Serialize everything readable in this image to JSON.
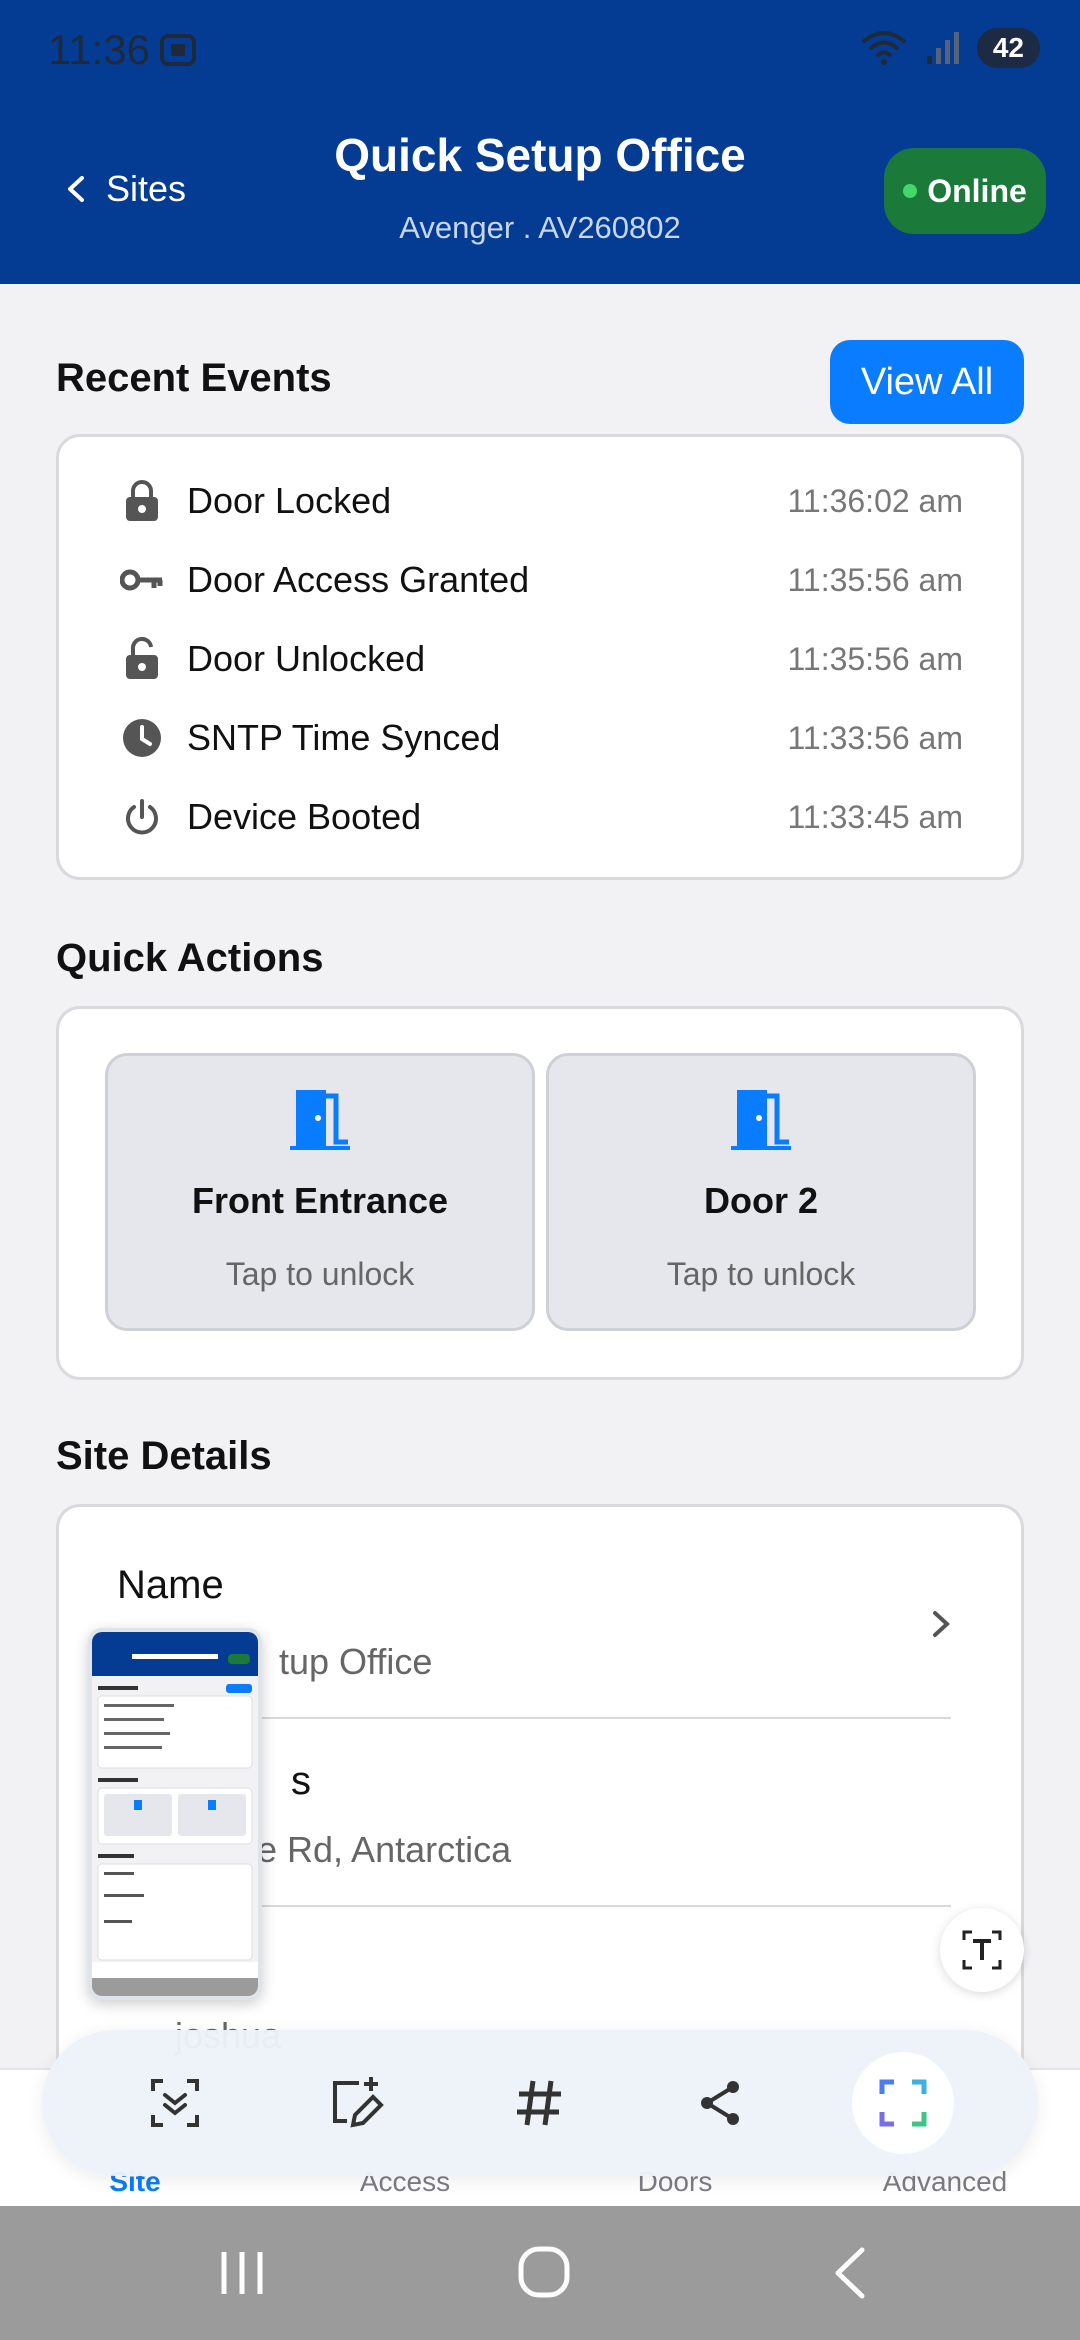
{
  "status": {
    "time": "11:36",
    "battery": "42"
  },
  "header": {
    "back_label": "Sites",
    "title": "Quick Setup Office",
    "subtitle": "Avenger . AV260802",
    "online_label": "Online"
  },
  "recent_events": {
    "title": "Recent Events",
    "view_all_label": "View All",
    "items": [
      {
        "icon": "lock-icon",
        "label": "Door Locked",
        "time": "11:36:02 am"
      },
      {
        "icon": "key-icon",
        "label": "Door Access Granted",
        "time": "11:35:56 am"
      },
      {
        "icon": "lock-open-icon",
        "label": "Door Unlocked",
        "time": "11:35:56 am"
      },
      {
        "icon": "clock-icon",
        "label": "SNTP Time Synced",
        "time": "11:33:56 am"
      },
      {
        "icon": "power-icon",
        "label": "Device Booted",
        "time": "11:33:45 am"
      }
    ]
  },
  "quick_actions": {
    "title": "Quick Actions",
    "items": [
      {
        "icon": "door-icon",
        "name": "Front Entrance",
        "subtitle": "Tap to unlock"
      },
      {
        "icon": "door-icon",
        "name": "Door 2",
        "subtitle": "Tap to unlock"
      }
    ]
  },
  "site_details": {
    "title": "Site Details",
    "name_label": "Name",
    "name_value_partial": "tup Office",
    "address_label_partial": "s",
    "address_value_partial": "e Rd, Antarctica",
    "owner_value_partial": "joshua"
  },
  "bottom_nav": {
    "items": [
      {
        "label": "Site",
        "active": true
      },
      {
        "label": "Access",
        "active": false
      },
      {
        "label": "Doors",
        "active": false
      },
      {
        "label": "Advanced",
        "active": false
      }
    ]
  },
  "colors": {
    "header_bg": "#043c94",
    "accent": "#0a7cff",
    "online_bg": "#1b7a3a"
  }
}
